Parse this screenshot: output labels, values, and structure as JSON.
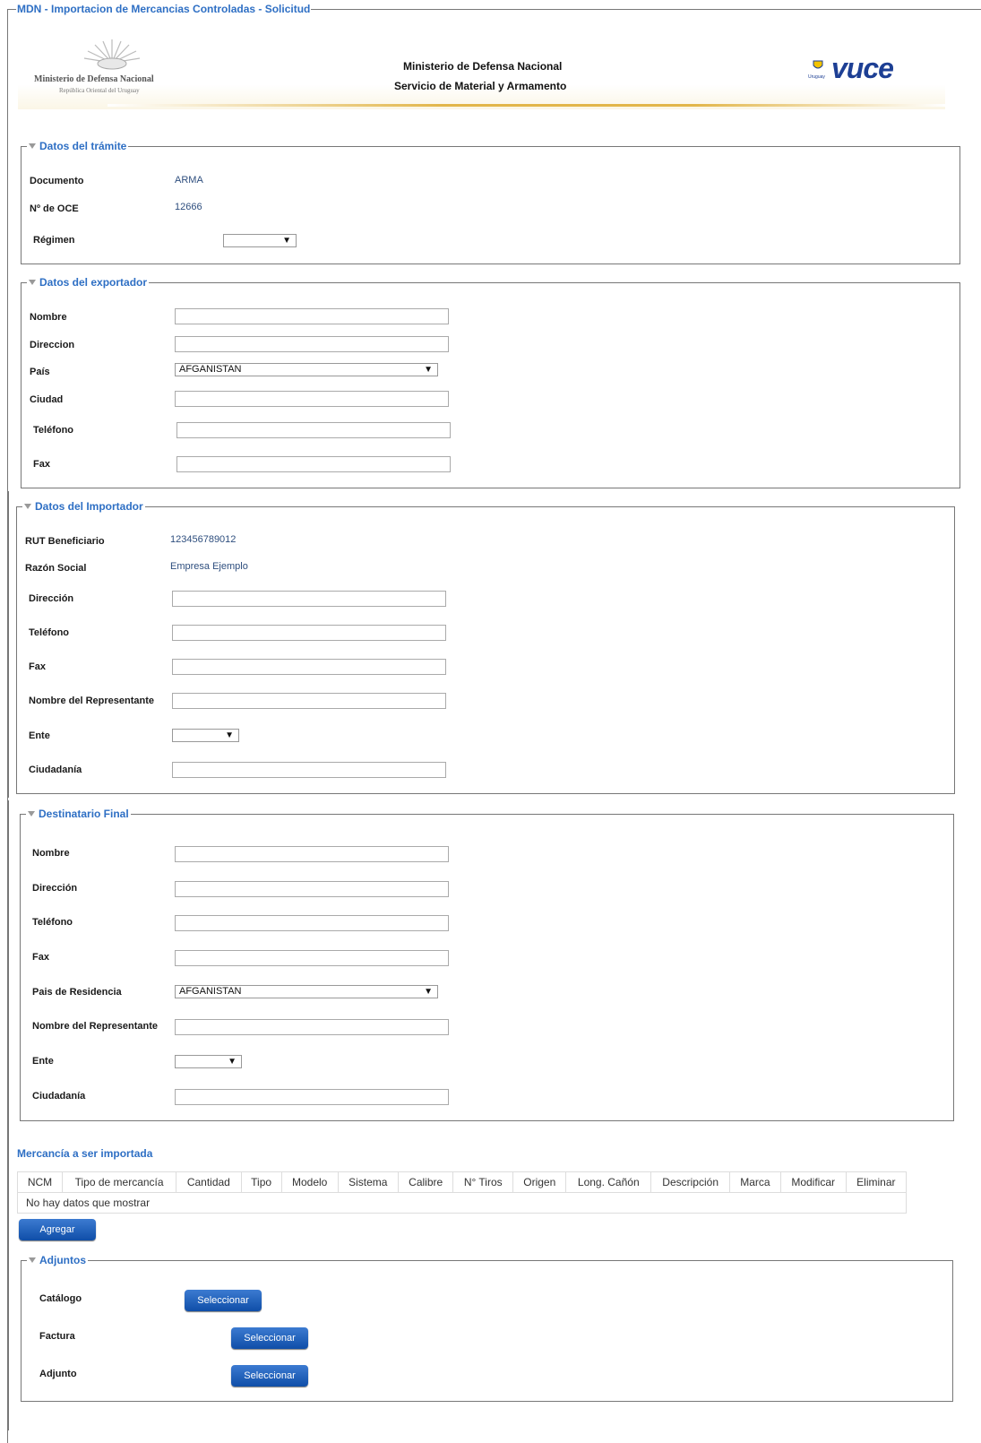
{
  "page_title": "MDN - Importacion de Mercancias Controladas - Solicitud",
  "header": {
    "ministry_logo_line1": "Ministerio de Defensa Nacional",
    "ministry_logo_line2": "República Oriental del Uruguay",
    "center_line1": "Ministerio de Defensa Nacional",
    "center_line2": "Servicio de Material y Armamento",
    "vuce_logo": "vuce",
    "vuce_sub": "Uruguay"
  },
  "tramite": {
    "title": "Datos del trámite",
    "documento_label": "Documento",
    "documento_value": "ARMA",
    "oce_label": "Nº de OCE",
    "oce_value": "12666",
    "regimen_label": "Régimen",
    "regimen_value": ""
  },
  "exportador": {
    "title": "Datos del exportador",
    "nombre_label": "Nombre",
    "direccion_label": "Direccion",
    "pais_label": "País",
    "pais_value": "AFGANISTAN",
    "ciudad_label": "Ciudad",
    "telefono_label": "Teléfono",
    "fax_label": "Fax"
  },
  "importador": {
    "title": "Datos del Importador",
    "rut_label": "RUT Beneficiario",
    "rut_value": "123456789012",
    "razon_label": "Razón Social",
    "razon_value": "Empresa Ejemplo",
    "direccion_label": "Dirección",
    "telefono_label": "Teléfono",
    "fax_label": "Fax",
    "representante_label": "Nombre del Representante",
    "ente_label": "Ente",
    "ente_value": "",
    "ciudadania_label": "Ciudadanía"
  },
  "destinatario": {
    "title": "Destinatario Final",
    "nombre_label": "Nombre",
    "direccion_label": "Dirección",
    "telefono_label": "Teléfono",
    "fax_label": "Fax",
    "pais_label": "Pais de Residencia",
    "pais_value": "AFGANISTAN",
    "representante_label": "Nombre del Representante",
    "ente_label": "Ente",
    "ente_value": "",
    "ciudadania_label": "Ciudadanía"
  },
  "mercancia": {
    "title": "Mercancía a ser importada",
    "columns": [
      "NCM",
      "Tipo de mercancía",
      "Cantidad",
      "Tipo",
      "Modelo",
      "Sistema",
      "Calibre",
      "N° Tiros",
      "Origen",
      "Long. Cañón",
      "Descripción",
      "Marca",
      "Modificar",
      "Eliminar"
    ],
    "empty_text": "No hay datos que mostrar",
    "add_button": "Agregar"
  },
  "adjuntos": {
    "title": "Adjuntos",
    "catalogo_label": "Catálogo",
    "factura_label": "Factura",
    "adjunto_label": "Adjunto",
    "select_button": "Seleccionar"
  }
}
